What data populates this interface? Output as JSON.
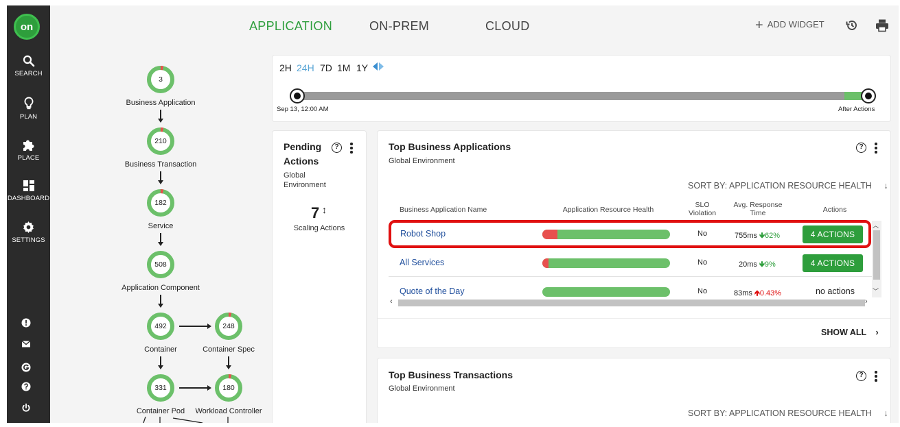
{
  "sidebar": {
    "logo": "on",
    "items": [
      {
        "label": "SEARCH",
        "icon": "search-icon"
      },
      {
        "label": "PLAN",
        "icon": "lightbulb-icon"
      },
      {
        "label": "PLACE",
        "icon": "puzzle-icon"
      },
      {
        "label": "DASHBOARD",
        "icon": "dashboard-icon"
      },
      {
        "label": "SETTINGS",
        "icon": "gear-icon"
      }
    ],
    "utility_icons": [
      "alert-icon",
      "mail-icon",
      "g-icon",
      "help-icon",
      "power-icon"
    ]
  },
  "header": {
    "tabs": [
      {
        "label": "APPLICATION",
        "active": true
      },
      {
        "label": "ON-PREM",
        "active": false
      },
      {
        "label": "CLOUD",
        "active": false
      }
    ],
    "add_widget": "ADD WIDGET",
    "active_color": "#2e9e3c"
  },
  "topology": {
    "nodes": [
      {
        "value": "3",
        "label": "Business Application"
      },
      {
        "value": "210",
        "label": "Business Transaction"
      },
      {
        "value": "182",
        "label": "Service"
      },
      {
        "value": "508",
        "label": "Application Component"
      },
      {
        "value": "492",
        "label": "Container"
      },
      {
        "value": "248",
        "label": "Container Spec"
      },
      {
        "value": "331",
        "label": "Container Pod"
      },
      {
        "value": "180",
        "label": "Workload Controller"
      }
    ]
  },
  "timeline": {
    "options": [
      "2H",
      "24H",
      "7D",
      "1M",
      "1Y"
    ],
    "selected": "24H",
    "start_label": "Sep 13, 12:00 AM",
    "end_label": "After Actions"
  },
  "pending": {
    "title_line1": "Pending",
    "title_line2": "Actions",
    "sub_line1": "Global",
    "sub_line2": "Environment",
    "count": "7",
    "count_label": "Scaling Actions"
  },
  "top_apps": {
    "title": "Top Business Applications",
    "subtitle": "Global Environment",
    "sort_label": "SORT BY: APPLICATION RESOURCE HEALTH",
    "columns": {
      "name": "Business Application Name",
      "health": "Application Resource Health",
      "slo_line1": "SLO",
      "slo_line2": "Violation",
      "resp_line1": "Avg. Response",
      "resp_line2": "Time",
      "actions": "Actions"
    },
    "rows": [
      {
        "name": "Robot Shop",
        "health_bad_fraction": 0.12,
        "slo": "No",
        "resp": "755ms",
        "trend": "down",
        "change": "62%",
        "action": "4 ACTIONS",
        "has_button": true,
        "highlighted": true
      },
      {
        "name": "All Services",
        "health_bad_fraction": 0.05,
        "slo": "No",
        "resp": "20ms",
        "trend": "down",
        "change": "9%",
        "action": "4 ACTIONS",
        "has_button": true,
        "highlighted": false
      },
      {
        "name": "Quote of the Day",
        "health_bad_fraction": 0.0,
        "slo": "No",
        "resp": "83ms",
        "trend": "up",
        "change": "0.43%",
        "action": "no actions",
        "has_button": false,
        "highlighted": false
      }
    ],
    "show_all": "SHOW ALL"
  },
  "top_transactions": {
    "title": "Top Business Transactions",
    "subtitle": "Global Environment",
    "sort_label": "SORT BY: APPLICATION RESOURCE HEALTH"
  }
}
